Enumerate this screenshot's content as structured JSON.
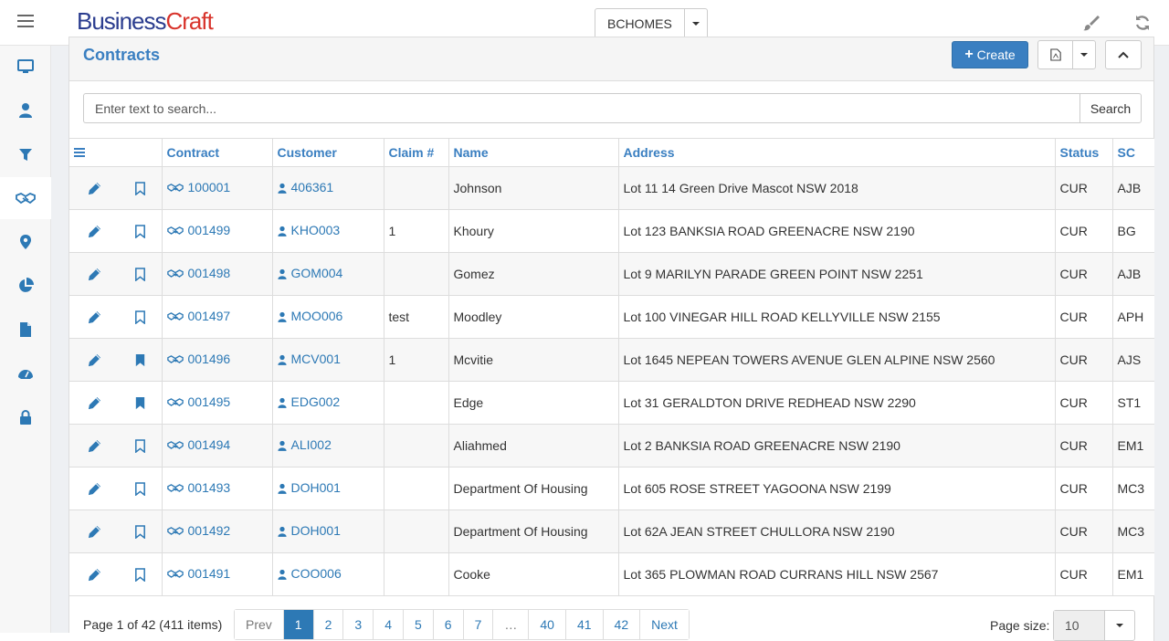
{
  "app": {
    "logo_part1": "Business",
    "logo_part2": "Craft",
    "company": "BCHOMES"
  },
  "colors": {
    "accent": "#3a7fc1",
    "link": "#2d79b5",
    "logo_blue": "#2b3d8f",
    "logo_red": "#d8342c"
  },
  "sidebar": {
    "items": [
      {
        "icon": "monitor-icon"
      },
      {
        "icon": "user-icon"
      },
      {
        "icon": "filter-icon"
      },
      {
        "icon": "handshake-icon",
        "active": true
      },
      {
        "icon": "map-marker-icon"
      },
      {
        "icon": "pie-chart-icon"
      },
      {
        "icon": "file-icon"
      },
      {
        "icon": "dashboard-icon"
      },
      {
        "icon": "lock-icon"
      }
    ]
  },
  "panel": {
    "title": "Contracts",
    "create_label": "Create",
    "search_placeholder": "Enter text to search...",
    "search_button": "Search"
  },
  "table": {
    "columns": [
      "Contract",
      "Customer",
      "Claim #",
      "Name",
      "Address",
      "Status",
      "SC"
    ],
    "rows": [
      {
        "bookmarked": false,
        "contract": "100001",
        "customer": "406361",
        "claim": "",
        "name": "Johnson",
        "address": "Lot 11 14 Green Drive Mascot NSW 2018",
        "status": "CUR",
        "sc": "AJB"
      },
      {
        "bookmarked": false,
        "contract": "001499",
        "customer": "KHO003",
        "claim": "1",
        "name": "Khoury",
        "address": "Lot 123 BANKSIA ROAD GREENACRE NSW 2190",
        "status": "CUR",
        "sc": "BG"
      },
      {
        "bookmarked": false,
        "contract": "001498",
        "customer": "GOM004",
        "claim": "",
        "name": "Gomez",
        "address": "Lot 9 MARILYN PARADE GREEN POINT NSW 2251",
        "status": "CUR",
        "sc": "AJB"
      },
      {
        "bookmarked": false,
        "contract": "001497",
        "customer": "MOO006",
        "claim": "test",
        "name": "Moodley",
        "address": "Lot 100 VINEGAR HILL ROAD KELLYVILLE NSW 2155",
        "status": "CUR",
        "sc": "APH"
      },
      {
        "bookmarked": true,
        "contract": "001496",
        "customer": "MCV001",
        "claim": "1",
        "name": "Mcvitie",
        "address": "Lot 1645 NEPEAN TOWERS AVENUE GLEN ALPINE NSW 2560",
        "status": "CUR",
        "sc": "AJS"
      },
      {
        "bookmarked": true,
        "contract": "001495",
        "customer": "EDG002",
        "claim": "",
        "name": "Edge",
        "address": "Lot 31 GERALDTON DRIVE REDHEAD NSW 2290",
        "status": "CUR",
        "sc": "ST1"
      },
      {
        "bookmarked": false,
        "contract": "001494",
        "customer": "ALI002",
        "claim": "",
        "name": "Aliahmed",
        "address": "Lot 2 BANKSIA ROAD GREENACRE NSW 2190",
        "status": "CUR",
        "sc": "EM1"
      },
      {
        "bookmarked": false,
        "contract": "001493",
        "customer": "DOH001",
        "claim": "",
        "name": "Department Of Housing",
        "address": "Lot 605 ROSE STREET YAGOONA NSW 2199",
        "status": "CUR",
        "sc": "MC3"
      },
      {
        "bookmarked": false,
        "contract": "001492",
        "customer": "DOH001",
        "claim": "",
        "name": "Department Of Housing",
        "address": "Lot 62A JEAN STREET CHULLORA NSW 2190",
        "status": "CUR",
        "sc": "MC3"
      },
      {
        "bookmarked": false,
        "contract": "001491",
        "customer": "COO006",
        "claim": "",
        "name": "Cooke",
        "address": "Lot 365 PLOWMAN ROAD CURRANS HILL NSW 2567",
        "status": "CUR",
        "sc": "EM1"
      }
    ]
  },
  "pager": {
    "info": "Page 1 of 42 (411 items)",
    "prev": "Prev",
    "next": "Next",
    "pages": [
      "1",
      "2",
      "3",
      "4",
      "5",
      "6",
      "7",
      "…",
      "40",
      "41",
      "42"
    ],
    "current": "1",
    "page_size_label": "Page size:",
    "page_size": "10"
  }
}
